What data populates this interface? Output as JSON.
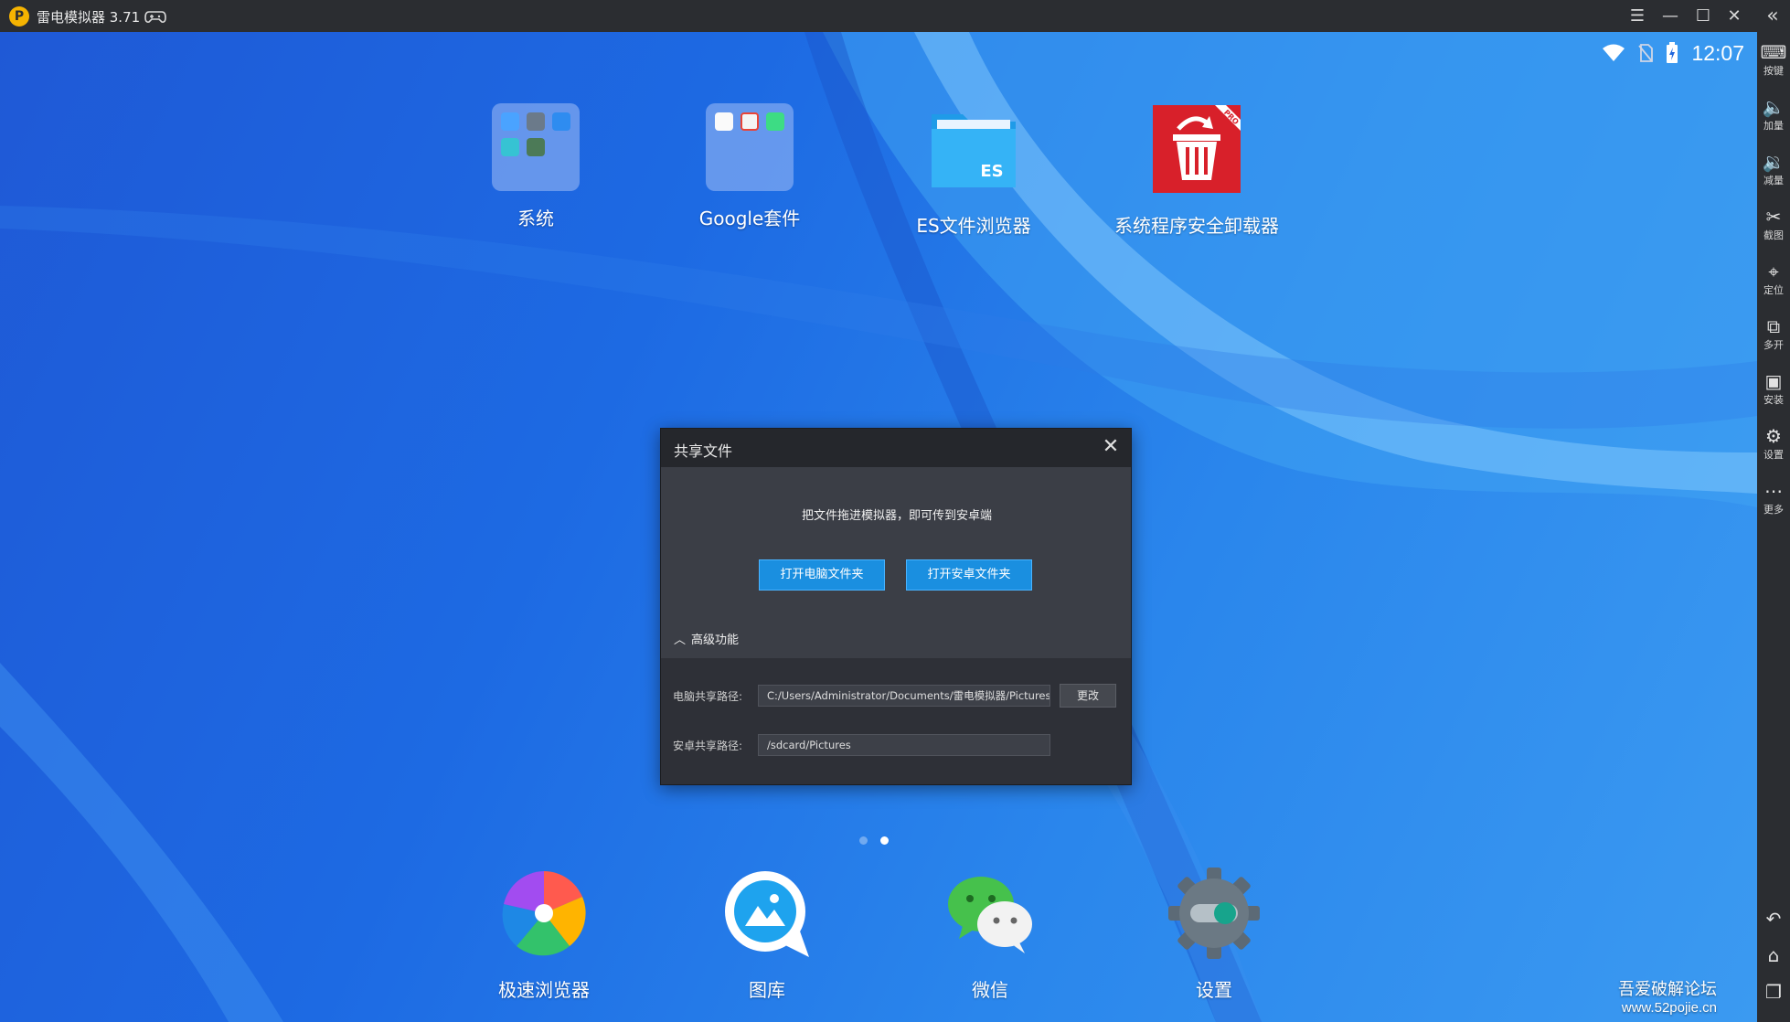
{
  "window": {
    "title": "雷电模拟器 3.71",
    "logo": "P",
    "min": "—",
    "max": "☐",
    "close": "✕",
    "menu": "☰",
    "collapse": "«"
  },
  "status": {
    "time": "12:07"
  },
  "desktop": {
    "top_apps": [
      {
        "label": "系统",
        "icon": "folder-icon"
      },
      {
        "label": "Google套件",
        "icon": "folder-icon"
      },
      {
        "label": "ES文件浏览器",
        "icon": "es-file-explorer-icon",
        "badge": "ES"
      },
      {
        "label": "系统程序安全卸载器",
        "icon": "uninstaller-icon",
        "badge": "PRO"
      }
    ],
    "dock_apps": [
      {
        "label": "极速浏览器",
        "icon": "browser-icon"
      },
      {
        "label": "图库",
        "icon": "gallery-icon"
      },
      {
        "label": "微信",
        "icon": "wechat-icon"
      },
      {
        "label": "设置",
        "icon": "settings-icon"
      }
    ],
    "page_indicator": {
      "count": 2,
      "active": 2
    }
  },
  "dialog": {
    "title": "共享文件",
    "message": "把文件拖进模拟器，即可传到安卓端",
    "btn_pc": "打开电脑文件夹",
    "btn_android": "打开安卓文件夹",
    "advanced": "高级功能",
    "pc_path_label": "电脑共享路径:",
    "pc_path": "C:/Users/Administrator/Documents/雷电模拟器/Pictures",
    "change": "更改",
    "android_path_label": "安卓共享路径:",
    "android_path": "/sdcard/Pictures"
  },
  "sidebar": [
    {
      "label": "按键",
      "icon": "keyboard-icon"
    },
    {
      "label": "加量",
      "icon": "volume-up-icon"
    },
    {
      "label": "减量",
      "icon": "volume-down-icon"
    },
    {
      "label": "截图",
      "icon": "scissors-icon"
    },
    {
      "label": "定位",
      "icon": "location-icon"
    },
    {
      "label": "多开",
      "icon": "multi-instance-icon"
    },
    {
      "label": "安装",
      "icon": "apk-install-icon"
    },
    {
      "label": "设置",
      "icon": "gear-icon"
    },
    {
      "label": "更多",
      "icon": "more-icon"
    }
  ],
  "nav": {
    "back": "back-icon",
    "home": "home-icon",
    "recents": "recents-icon"
  },
  "watermark": {
    "line1": "吾爱破解论坛",
    "line2": "www.52pojie.cn"
  },
  "colors": {
    "screen": "#1f62df",
    "titlebar": "#2b2d31",
    "dialog": "#3b3e46",
    "accent": "#1a8fe0"
  }
}
